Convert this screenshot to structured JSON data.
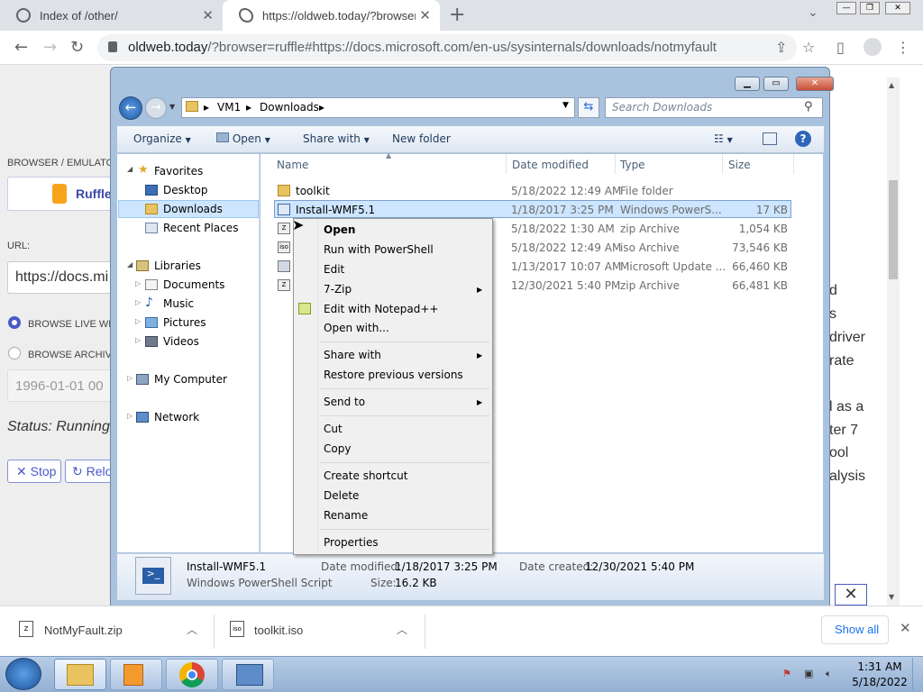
{
  "browser": {
    "tabs": [
      {
        "title": "Index of /other/"
      },
      {
        "title": "https://oldweb.today/?browser=r"
      }
    ],
    "url_host": "oldweb.today",
    "url_rest": "/?browser=ruffle#https://docs.microsoft.com/en-us/sysinternals/downloads/notmyfault"
  },
  "webpage": {
    "browser_emulator_label": "BROWSER / EMULATOR",
    "ruffle_label": "Ruffle",
    "url_label": "URL:",
    "url_value": "https://docs.mi",
    "browse_live": "BROWSE LIVE WEB",
    "browse_archive": "BROWSE ARCHIVE",
    "date_value": "1996-01-01 00",
    "status": "Status: Running",
    "stop": "Stop",
    "reload": "Relo",
    "right_text": [
      "d",
      "s",
      "driver",
      "rate",
      "l as a",
      "ter 7",
      "ool",
      "alysis"
    ]
  },
  "explorer": {
    "breadcrumb": [
      "VM1",
      "Downloads"
    ],
    "search_placeholder": "Search Downloads",
    "commands": [
      "Organize",
      "Open",
      "Share with",
      "New folder"
    ],
    "nav": {
      "favorites": "Favorites",
      "desktop": "Desktop",
      "downloads": "Downloads",
      "recent": "Recent Places",
      "libraries": "Libraries",
      "documents": "Documents",
      "music": "Music",
      "pictures": "Pictures",
      "videos": "Videos",
      "computer": "My Computer",
      "network": "Network"
    },
    "columns": [
      "Name",
      "Date modified",
      "Type",
      "Size"
    ],
    "files": [
      {
        "name": "toolkit",
        "date": "5/18/2022 12:49 AM",
        "type": "File folder",
        "size": ""
      },
      {
        "name": "Install-WMF5.1",
        "date": "1/18/2017 3:25 PM",
        "type": "Windows PowerS...",
        "size": "17 KB"
      },
      {
        "name": "",
        "date": "5/18/2022 1:30 AM",
        "type": "zip Archive",
        "size": "1,054 KB"
      },
      {
        "name": "",
        "date": "5/18/2022 12:49 AM",
        "type": "iso Archive",
        "size": "73,546 KB"
      },
      {
        "name": "",
        "date": "1/13/2017 10:07 AM",
        "type": "Microsoft Update ...",
        "size": "66,460 KB"
      },
      {
        "name": "",
        "date": "12/30/2021 5:40 PM",
        "type": "zip Archive",
        "size": "66,481 KB"
      }
    ],
    "details": {
      "name": "Install-WMF5.1",
      "kind": "Windows PowerShell Script",
      "modified_label": "Date modified:",
      "modified": "1/18/2017 3:25 PM",
      "size_label": "Size:",
      "size": "16.2 KB",
      "created_label": "Date created:",
      "created": "12/30/2021 5:40 PM"
    }
  },
  "context_menu": {
    "open": "Open",
    "run_ps": "Run with PowerShell",
    "edit": "Edit",
    "zip": "7-Zip",
    "notepad": "Edit with Notepad++",
    "open_with": "Open with...",
    "share_with": "Share with",
    "restore": "Restore previous versions",
    "send_to": "Send to",
    "cut": "Cut",
    "copy": "Copy",
    "create_shortcut": "Create shortcut",
    "delete": "Delete",
    "rename": "Rename",
    "properties": "Properties"
  },
  "downloads": [
    {
      "name": "NotMyFault.zip"
    },
    {
      "name": "toolkit.iso"
    }
  ],
  "downloads_show_all": "Show all",
  "taskbar": {
    "time": "1:31 AM",
    "date": "5/18/2022"
  }
}
